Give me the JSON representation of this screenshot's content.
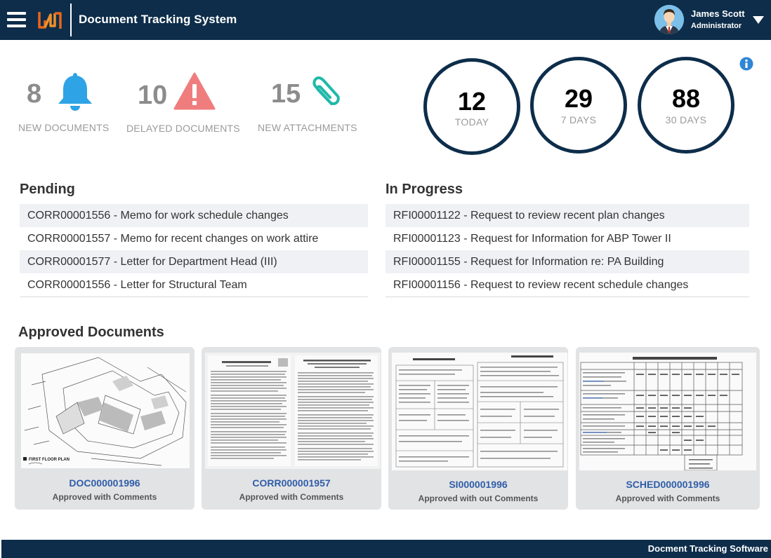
{
  "header": {
    "title": "Document Tracking System",
    "menu_icon": "hamburger-menu-icon",
    "logo_icon": "brand-logo",
    "user": {
      "name": "James Scott",
      "role": "Administrator",
      "avatar_icon": "user-avatar",
      "caret_icon": "caret-down-icon"
    }
  },
  "stats": [
    {
      "count": "8",
      "label": "NEW DOCUMENTS",
      "icon": "bell-icon",
      "color": "#2ea3e6"
    },
    {
      "count": "10",
      "label": "DELAYED DOCUMENTS",
      "icon": "warning-icon",
      "color": "#f07d7d"
    },
    {
      "count": "15",
      "label": "NEW ATTACHMENTS",
      "icon": "paperclip-icon",
      "color": "#1fb9a9"
    }
  ],
  "counters": [
    {
      "value": "12",
      "label": "TODAY"
    },
    {
      "value": "29",
      "label": "7 DAYS"
    },
    {
      "value": "88",
      "label": "30 DAYS"
    }
  ],
  "info_icon": "info-icon",
  "pending": {
    "title": "Pending",
    "items": [
      "CORR00001556 - Memo for work schedule changes",
      "CORR00001557 - Memo for recent changes on work attire",
      "CORR00001577 - Letter for Department Head (III)",
      "CORR00001556 - Letter for Structural Team"
    ]
  },
  "in_progress": {
    "title": "In Progress",
    "items": [
      "RFI00001122 - Request to review recent plan changes",
      "RFI00001123 - Request for Information for ABP Tower II",
      "RFI00001155 - Request for Information re: PA Building",
      "RFI00001156 - Request to review recent schedule changes"
    ]
  },
  "approved": {
    "title": "Approved Documents",
    "cards": [
      {
        "id": "DOC000001996",
        "status": "Approved with Comments",
        "thumb": "floor-plan-thumbnail"
      },
      {
        "id": "CORR000001957",
        "status": "Approved with Comments",
        "thumb": "letter-thumbnail"
      },
      {
        "id": "SI000001996",
        "status": "Approved with out Comments",
        "thumb": "form-thumbnail"
      },
      {
        "id": "SCHED000001996",
        "status": "Approved with Comments",
        "thumb": "schedule-table-thumbnail"
      }
    ]
  },
  "footer": {
    "text": "Docment Tracking Software"
  },
  "colors": {
    "navy": "#0d2d4a",
    "link_blue": "#2f5da8",
    "card_bg": "#e2e3e5",
    "row_alt": "#eff1f4"
  }
}
